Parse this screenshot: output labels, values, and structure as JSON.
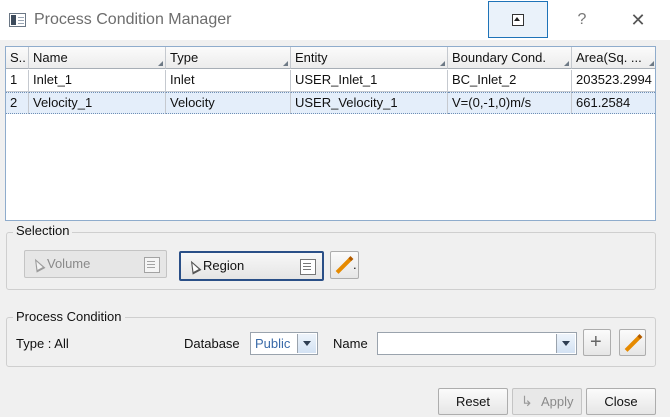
{
  "window": {
    "title": "Process Condition Manager",
    "help_glyph": "?",
    "close_glyph": "✕"
  },
  "table": {
    "columns": [
      "S..",
      "Name",
      "Type",
      "Entity",
      "Boundary Cond.",
      "Area(Sq. ..."
    ],
    "rows": [
      [
        "1",
        "Inlet_1",
        "Inlet",
        "USER_Inlet_1",
        "BC_Inlet_2",
        "203523.2994"
      ],
      [
        "2",
        "Velocity_1",
        "Velocity",
        "USER_Velocity_1",
        "V=(0,-1,0)m/s",
        "661.2584"
      ]
    ],
    "selected_row": 1
  },
  "selection": {
    "label": "Selection",
    "volume_label": "Volume",
    "region_label": "Region",
    "edit_suffix": "."
  },
  "process_condition": {
    "label": "Process Condition",
    "type_text": "Type : All",
    "database_label": "Database",
    "database_value": "Public",
    "name_label": "Name",
    "name_value": "",
    "add_glyph": "+"
  },
  "footer": {
    "reset": "Reset",
    "apply": "Apply",
    "close": "Close"
  },
  "colors": {
    "accent": "#1e73b8",
    "selected_row": "#e4eefa",
    "pencil": "#e68a00"
  }
}
